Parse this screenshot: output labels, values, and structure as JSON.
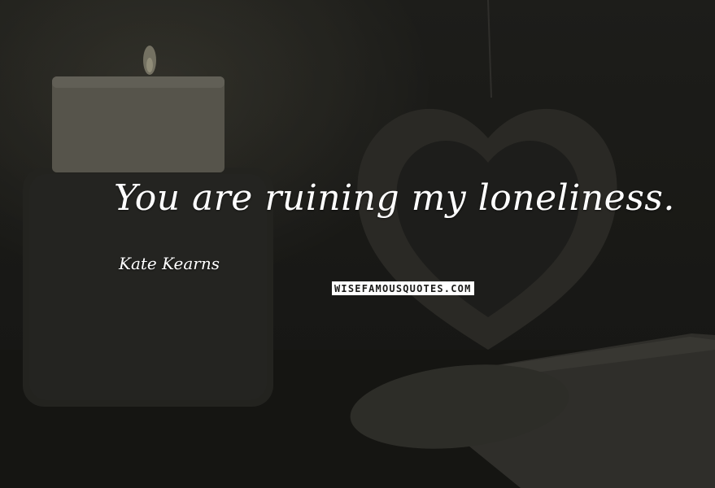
{
  "quote": {
    "text": "You are ruining my loneliness.",
    "author": "Kate Kearns"
  },
  "watermark": {
    "text": "WISEFAMOUSQUOTES.COM"
  },
  "colors": {
    "background": "#1f1f1c",
    "text": "#ffffff",
    "watermark_bg": "#ffffff",
    "watermark_text": "#1a1a18"
  },
  "icons": [
    "candle-icon",
    "heart-decoration-icon"
  ]
}
